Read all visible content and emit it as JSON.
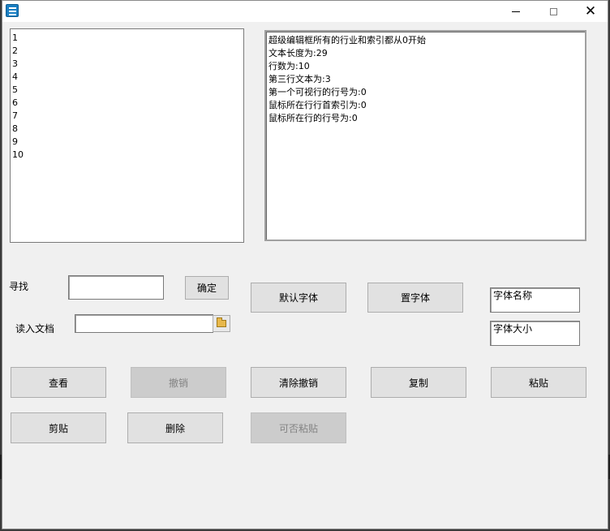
{
  "titlebar": {
    "icon": "app-icon",
    "minimize": "—",
    "maximize": "□",
    "close": "✕"
  },
  "lines_box": {
    "lines": [
      "1",
      "2",
      "3",
      "4",
      "5",
      "6",
      "7",
      "8",
      "9",
      "10"
    ]
  },
  "info_box": {
    "lines": [
      "超级编辑框所有的行业和索引都从0开始",
      "文本长度为:29",
      "行数为:10",
      "第三行文本为:3",
      "第一个可视行的行号为:0",
      "鼠标所在行行首索引为:0",
      "鼠标所在行的行号为:0"
    ]
  },
  "find": {
    "label": "寻找",
    "value": "",
    "confirm": "确定"
  },
  "read_doc": {
    "label": "读入文档",
    "value": "",
    "browse_icon": "folder-open-icon"
  },
  "font_buttons": {
    "default_font": "默认字体",
    "set_font": "置字体"
  },
  "font_fields": {
    "name": "字体名称",
    "size": "字体大小"
  },
  "actions_row1": {
    "view": "查看",
    "undo": "撤销",
    "clear_undo": "清除撤销",
    "copy": "复制",
    "paste": "粘贴"
  },
  "actions_row2": {
    "cut": "剪贴",
    "delete": "删除",
    "can_paste": "可否粘贴"
  },
  "states": {
    "undo_enabled": false,
    "can_paste_enabled": false
  }
}
